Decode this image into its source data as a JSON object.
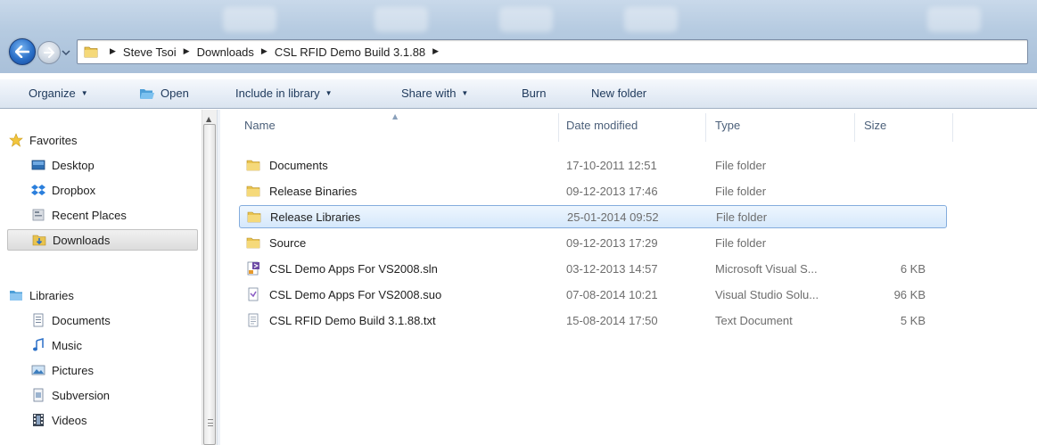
{
  "address": {
    "crumbs": [
      "Steve Tsoi",
      "Downloads",
      "CSL RFID Demo Build 3.1.88"
    ]
  },
  "toolbar": {
    "organize": "Organize",
    "open": "Open",
    "include_in_library": "Include in library",
    "share_with": "Share with",
    "burn": "Burn",
    "new_folder": "New folder"
  },
  "navpane": {
    "favorites": {
      "label": "Favorites",
      "items": [
        {
          "label": "Desktop",
          "icon": "desktop-icon"
        },
        {
          "label": "Dropbox",
          "icon": "dropbox-icon"
        },
        {
          "label": "Recent Places",
          "icon": "recent-places-icon"
        },
        {
          "label": "Downloads",
          "icon": "downloads-folder-icon",
          "selected": true
        }
      ]
    },
    "libraries": {
      "label": "Libraries",
      "items": [
        {
          "label": "Documents",
          "icon": "documents-icon"
        },
        {
          "label": "Music",
          "icon": "music-icon"
        },
        {
          "label": "Pictures",
          "icon": "pictures-icon"
        },
        {
          "label": "Subversion",
          "icon": "subversion-icon"
        },
        {
          "label": "Videos",
          "icon": "videos-icon"
        }
      ]
    }
  },
  "filelist": {
    "columns": {
      "name": "Name",
      "date_modified": "Date modified",
      "type": "Type",
      "size": "Size"
    },
    "rows": [
      {
        "name": "Documents",
        "date": "17-10-2011 12:51",
        "type": "File folder",
        "size": "",
        "icon": "folder-icon"
      },
      {
        "name": "Release Binaries",
        "date": "09-12-2013 17:46",
        "type": "File folder",
        "size": "",
        "icon": "folder-icon"
      },
      {
        "name": "Release Libraries",
        "date": "25-01-2014 09:52",
        "type": "File folder",
        "size": "",
        "icon": "folder-icon",
        "selected": true
      },
      {
        "name": "Source",
        "date": "09-12-2013 17:29",
        "type": "File folder",
        "size": "",
        "icon": "folder-icon"
      },
      {
        "name": "CSL Demo Apps For VS2008.sln",
        "date": "03-12-2013 14:57",
        "type": "Microsoft Visual S...",
        "size": "6 KB",
        "icon": "vs-solution-icon"
      },
      {
        "name": "CSL Demo Apps For VS2008.suo",
        "date": "07-08-2014 10:21",
        "type": "Visual Studio Solu...",
        "size": "96 KB",
        "icon": "suo-file-icon"
      },
      {
        "name": "CSL RFID Demo Build 3.1.88.txt",
        "date": "15-08-2014 17:50",
        "type": "Text Document",
        "size": "5 KB",
        "icon": "text-file-icon"
      }
    ]
  },
  "colors": {
    "selection_border": "#84acdd",
    "toolbar_text": "#1e395b",
    "header_text": "#4c607a",
    "folder_yellow": "#e8c34f"
  }
}
